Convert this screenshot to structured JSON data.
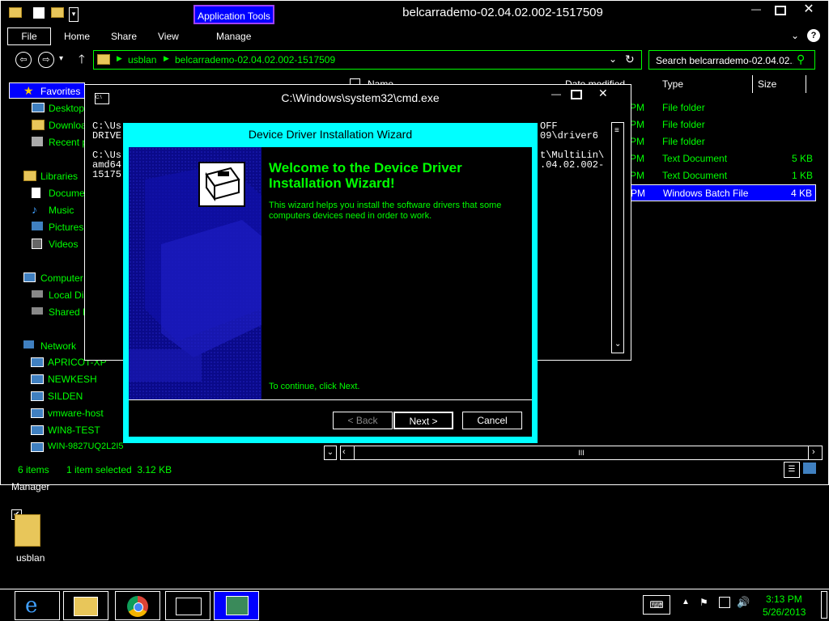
{
  "explorer": {
    "title": "belcarrademo-02.04.02.002-1517509",
    "app_tools_label": "Application Tools",
    "ribbon_tabs": [
      "File",
      "Home",
      "Share",
      "View",
      "Manage"
    ],
    "address": {
      "part1": "usblan",
      "part2": "belcarrademo-02.04.02.002-1517509"
    },
    "search_placeholder": "Search belcarrademo-02.04.02...",
    "columns": {
      "name": "Name",
      "date": "Date modified",
      "type": "Type",
      "size": "Size"
    },
    "files": [
      {
        "pm": "PM",
        "type": "File folder",
        "size": ""
      },
      {
        "pm": "PM",
        "type": "File folder",
        "size": ""
      },
      {
        "pm": "PM",
        "type": "File folder",
        "size": ""
      },
      {
        "pm": "PM",
        "type": "Text Document",
        "size": "5 KB"
      },
      {
        "pm": "PM",
        "type": "Text Document",
        "size": "1 KB"
      },
      {
        "pm": "PM",
        "type": "Windows Batch File",
        "size": "4 KB"
      }
    ],
    "nav": {
      "favorites": "Favorites",
      "desktop": "Desktop",
      "downloads": "Downloa",
      "recent": "Recent p",
      "libraries": "Libraries",
      "documents": "Docume",
      "music": "Music",
      "pictures": "Pictures",
      "videos": "Videos",
      "computer": "Computer",
      "local_disk": "Local Dis",
      "shared": "Shared F",
      "network": "Network",
      "net_items": [
        "APRICOT-XP",
        "NEWKESH",
        "SILDEN",
        "vmware-host",
        "WIN8-TEST",
        "WIN-9827UQ2L2I5"
      ]
    },
    "status": {
      "items": "6 items",
      "selected": "1 item selected  3.12 KB"
    }
  },
  "cmd": {
    "title": "C:\\Windows\\system32\\cmd.exe",
    "icon_text": "C:\\",
    "left_lines": [
      "C:\\Us",
      "DRIVE",
      "",
      "C:\\Us",
      "amd64",
      "15175"
    ],
    "right_lines": [
      "OFF",
      "09\\driver6",
      "",
      "t\\MultiLin\\",
      ".04.02.002-",
      ""
    ]
  },
  "wizard": {
    "title": "Device Driver Installation Wizard",
    "heading": "Welcome to the Device Driver Installation Wizard!",
    "body": "This wizard helps you install the software drivers that some computers devices need in order to work.",
    "continue": "To continue, click Next.",
    "back": "< Back",
    "next": "Next >",
    "cancel": "Cancel"
  },
  "desktop": {
    "manager_label": "Manager",
    "folder_label": "usblan"
  },
  "taskbar": {
    "time": "3:13 PM",
    "date": "5/26/2013"
  },
  "colors": {
    "accent_green": "#00ff00",
    "wizard_cyan": "#00ffff",
    "selection_blue": "#0000ff",
    "app_tools_purple": "#a040ff"
  }
}
